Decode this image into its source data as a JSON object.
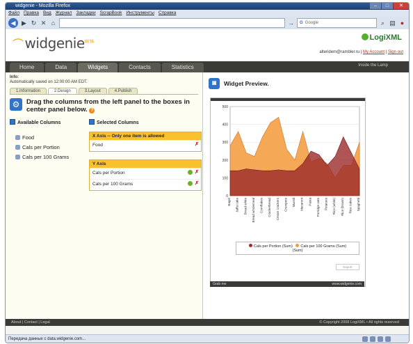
{
  "browser": {
    "title": "widgenie - Mozilla Firefox",
    "menu": [
      "Файл",
      "Правка",
      "Вид",
      "Журнал",
      "Закладки",
      "ScrapBook",
      "Инструменты",
      "Справка"
    ],
    "search_placeholder": "Google",
    "status": "Передача данных с data.widgenie.com..."
  },
  "header": {
    "logo": "widgenie",
    "logo_beta": "BETA",
    "partner": "LogiXML",
    "user": "alteridem@rambler.ru",
    "my_account": "My Account",
    "sign_out": "Sign out"
  },
  "tabs": [
    "Home",
    "Data",
    "Widgets",
    "Contacts",
    "Statistics"
  ],
  "tabs_right": "Inside the Lamp",
  "editor": {
    "info_label": "Info:",
    "saved_text": "Automatically saved on 12:00:00 AM EDT.",
    "steps": [
      "1.Information",
      "2.Design",
      "3.Layout",
      "4.Publish"
    ],
    "instruction": "Drag the columns from the left panel to the boxes in center panel below.",
    "available_title": "Available Columns",
    "available": [
      "Food",
      "Cals per Portion",
      "Cals per 100 Grams"
    ],
    "selected_title": "Selected Columns",
    "x_axis_title": "X Axis -- Only one item is allowed",
    "x_axis_items": [
      "Food"
    ],
    "y_axis_title": "Y Axis",
    "y_axis_items": [
      "Cals per Portion",
      "Cals per 100 Grams"
    ]
  },
  "preview": {
    "title": "Widget Preview.",
    "export": "Export",
    "footer_left": "Grab me",
    "footer_right": "www.widgenie.com"
  },
  "chart_data": {
    "type": "area",
    "categories": [
      "Bagel",
      "Jaffa cake",
      "Bread white",
      "Bread wholemeal",
      "Cornflakes",
      "Crackerbread",
      "Cream crackers",
      "Crumpets",
      "Muesli",
      "Macaroni",
      "Pasta",
      "Porridge oats",
      "Potatoes",
      "Rice (white)",
      "Rice (brown)",
      "Rice cakes",
      "Spaghetti"
    ],
    "ylim": [
      0,
      500
    ],
    "yticks": [
      0,
      100,
      200,
      300,
      400,
      500
    ],
    "series": [
      {
        "name": "Cals per Portion (Sum)",
        "color": "#9b2a2a",
        "values": [
          140,
          140,
          150,
          145,
          140,
          140,
          145,
          140,
          140,
          180,
          250,
          230,
          170,
          220,
          330,
          240,
          150
        ]
      },
      {
        "name": "Cals per 100 Grams (Sum)",
        "color": "#f39a3a",
        "values": [
          280,
          360,
          240,
          220,
          330,
          410,
          440,
          260,
          200,
          360,
          190,
          210,
          180,
          100,
          170,
          170,
          300
        ]
      }
    ],
    "legend_extra": "(Sum)"
  },
  "footer": {
    "links": "About | Contact | Legal",
    "copyright": "© Copyright 2008 LogiXML • All rights reserved"
  }
}
